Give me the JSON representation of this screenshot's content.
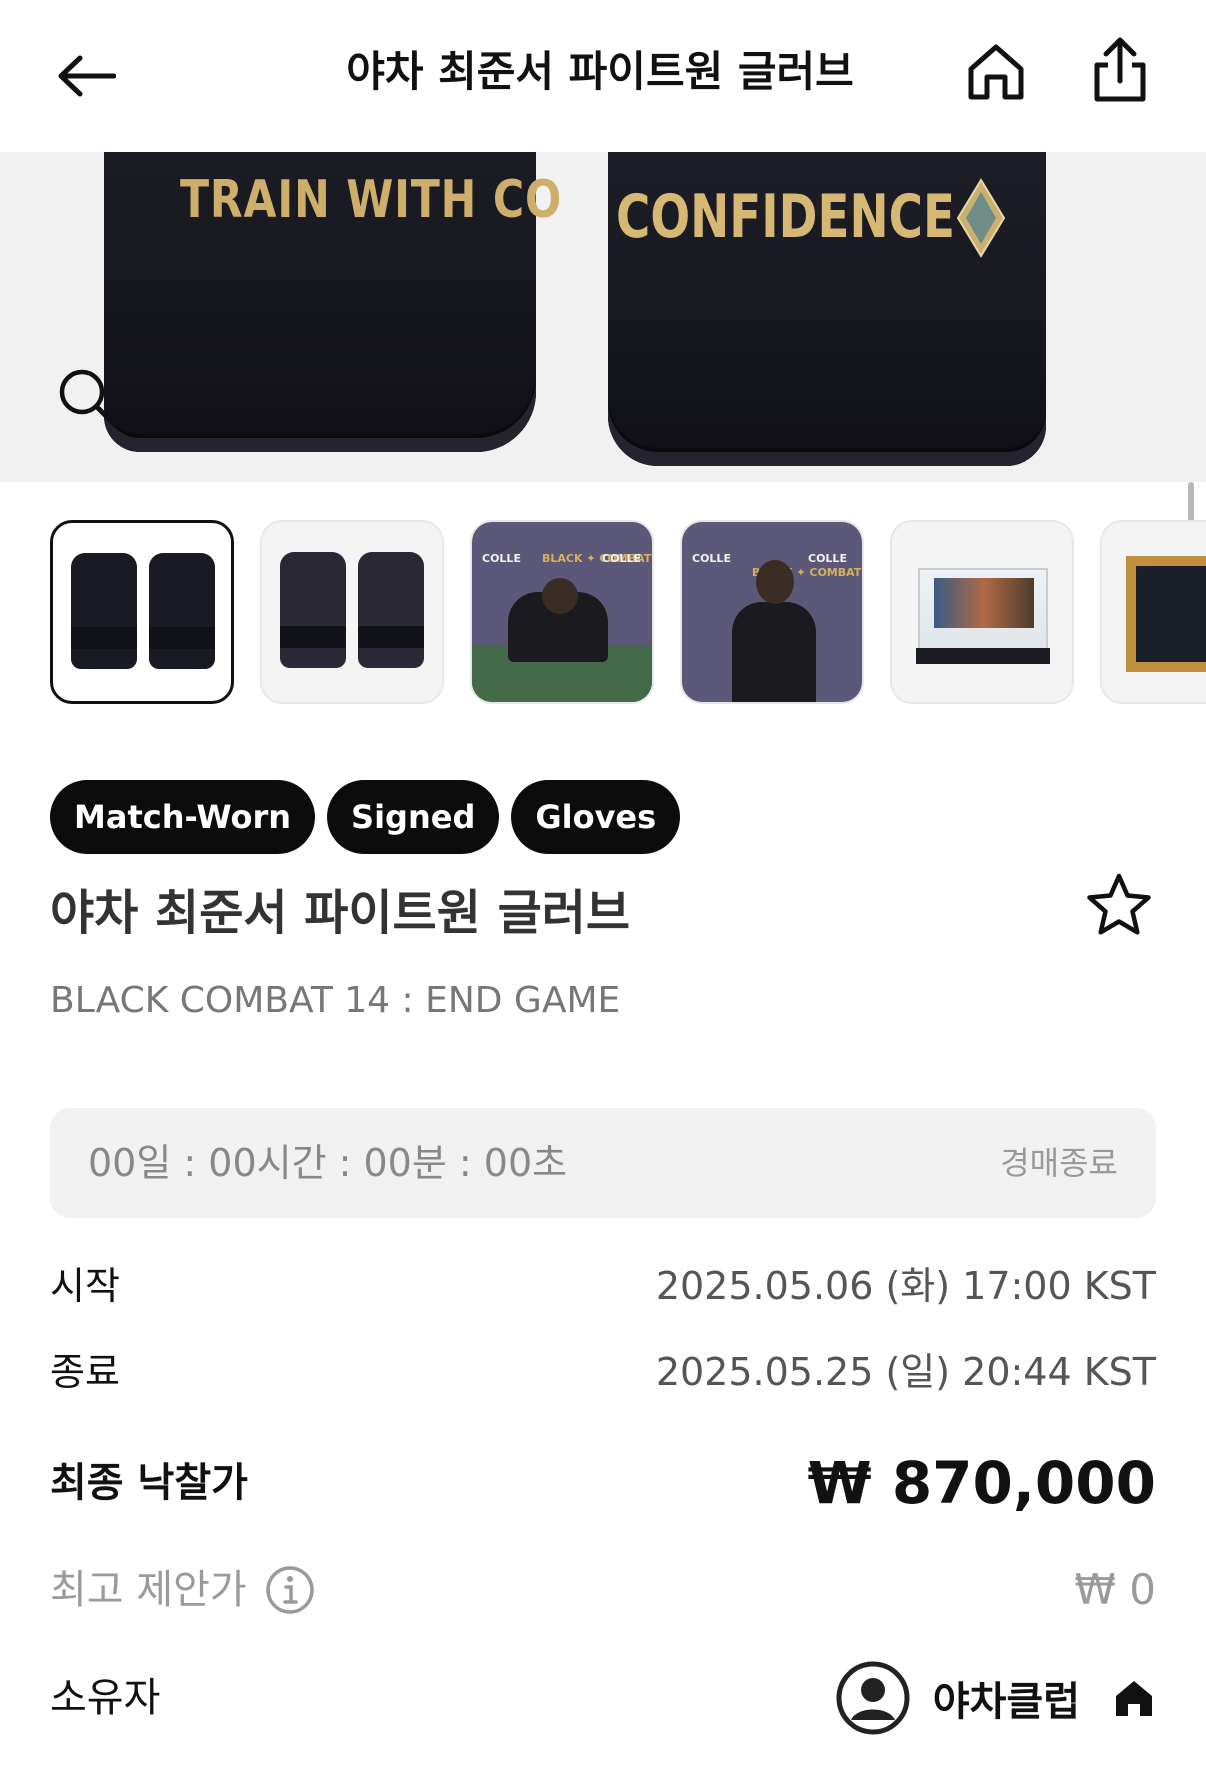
{
  "header": {
    "title": "야차 최준서 파이트원 글러브",
    "icons": [
      "back-arrow-icon",
      "home-icon",
      "share-icon"
    ]
  },
  "hero": {
    "glove_left_text": "TRAIN WITH CO",
    "glove_right_text": "CONFIDENCE",
    "zoom_icon": "search-icon"
  },
  "thumbnails": [
    {
      "label": "gloves-front",
      "selected": true
    },
    {
      "label": "gloves-back",
      "selected": false
    },
    {
      "label": "signing-photo",
      "selected": false
    },
    {
      "label": "fighter-photo",
      "selected": false
    },
    {
      "label": "display-case",
      "selected": false
    },
    {
      "label": "framed-gloves",
      "selected": false
    }
  ],
  "thumb_text": {
    "banner_logo_a": "COLLE",
    "banner_logo_b": "BLACK ✦ COMBAT"
  },
  "tags": [
    "Match-Worn",
    "Signed",
    "Gloves"
  ],
  "product": {
    "title": "야차 최준서 파이트원 글러브",
    "subtitle": "BLACK COMBAT 14 : END GAME"
  },
  "countdown": {
    "time": "00일 : 00시간 : 00분 : 00초",
    "status": "경매종료"
  },
  "details": {
    "start_label": "시작",
    "start_value": "2025.05.06 (화) 17:00 KST",
    "end_label": "종료",
    "end_value": "2025.05.25 (일) 20:44 KST",
    "final_label": "최종 낙찰가",
    "final_value": "₩ 870,000",
    "offer_label": "최고 제안가",
    "offer_value": "₩ 0",
    "owner_label": "소유자",
    "owner_name": "야차클럽"
  },
  "colors": {
    "tag_bg": "#0c0c0c",
    "countdown_bg": "#f1f1f1",
    "muted_text": "#9a9a9a"
  }
}
